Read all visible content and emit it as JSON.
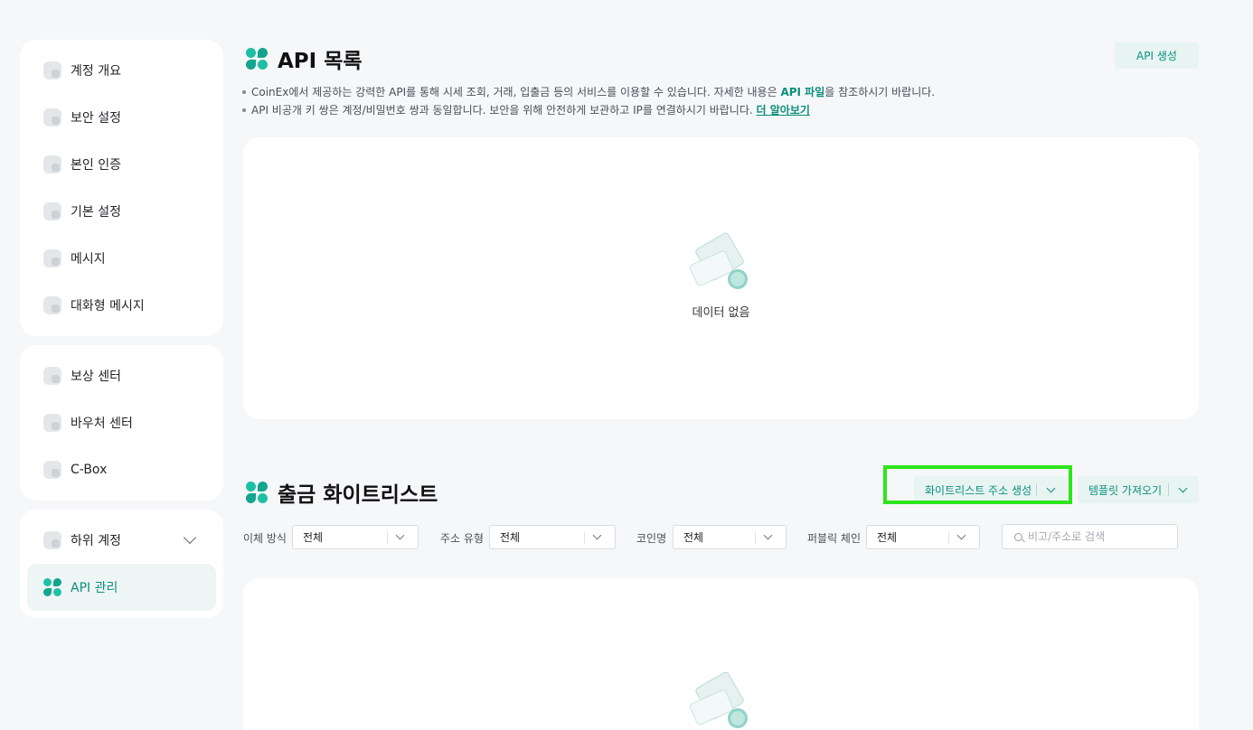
{
  "sidebar": {
    "group1": [
      {
        "label": "계정 개요",
        "icon": "pie-chart-icon"
      },
      {
        "label": "보안 설정",
        "icon": "shield-icon"
      },
      {
        "label": "본인 인증",
        "icon": "identity-badge-icon"
      },
      {
        "label": "기본 설정",
        "icon": "settings-cube-icon"
      },
      {
        "label": "메시지",
        "icon": "message-card-icon"
      },
      {
        "label": "대화형 메시지",
        "icon": "chat-bubble-icon"
      }
    ],
    "group2": [
      {
        "label": "보상 센터",
        "icon": "gift-icon"
      },
      {
        "label": "바우처 센터",
        "icon": "voucher-icon"
      },
      {
        "label": "C-Box",
        "icon": "box-icon"
      }
    ],
    "group3": [
      {
        "label": "하위 계정",
        "icon": "sub-account-icon"
      },
      {
        "label": "API 관리",
        "icon": "api-logo-icon"
      }
    ]
  },
  "api_section": {
    "title": "API 목록",
    "create_button": "API 생성",
    "note1_prefix": "CoinEx에서 제공하는 강력한 API를 통해 시세 조회, 거래, 입출금 등의 서비스를 이용할 수 있습니다. 자세한 내용은 ",
    "note1_link": "API 파일",
    "note1_suffix": "을 참조하시기 바랍니다.",
    "note2_prefix": "API 비공개 키 쌍은 계정/비밀번호 쌍과 동일합니다. 보안을 위해 안전하게 보관하고 IP를 연결하시기 바랍니다. ",
    "note2_link": "더 알아보기",
    "empty_text": "데이터 없음"
  },
  "whitelist_section": {
    "title": "출금 화이트리스트",
    "create_button": "화이트리스트 주소 생성",
    "template_button": "템플릿 가져오기",
    "filters": [
      {
        "label": "이체 방식",
        "value": "전체"
      },
      {
        "label": "주소 유형",
        "value": "전체"
      },
      {
        "label": "코인명",
        "value": "전체"
      },
      {
        "label": "퍼블릭 체인",
        "value": "전체"
      }
    ],
    "search_placeholder": "비고/주소로 검색"
  },
  "colors": {
    "accent": "#0c8f7e",
    "accent_bg": "#e7f4f2",
    "highlight": "#2ee51b"
  }
}
